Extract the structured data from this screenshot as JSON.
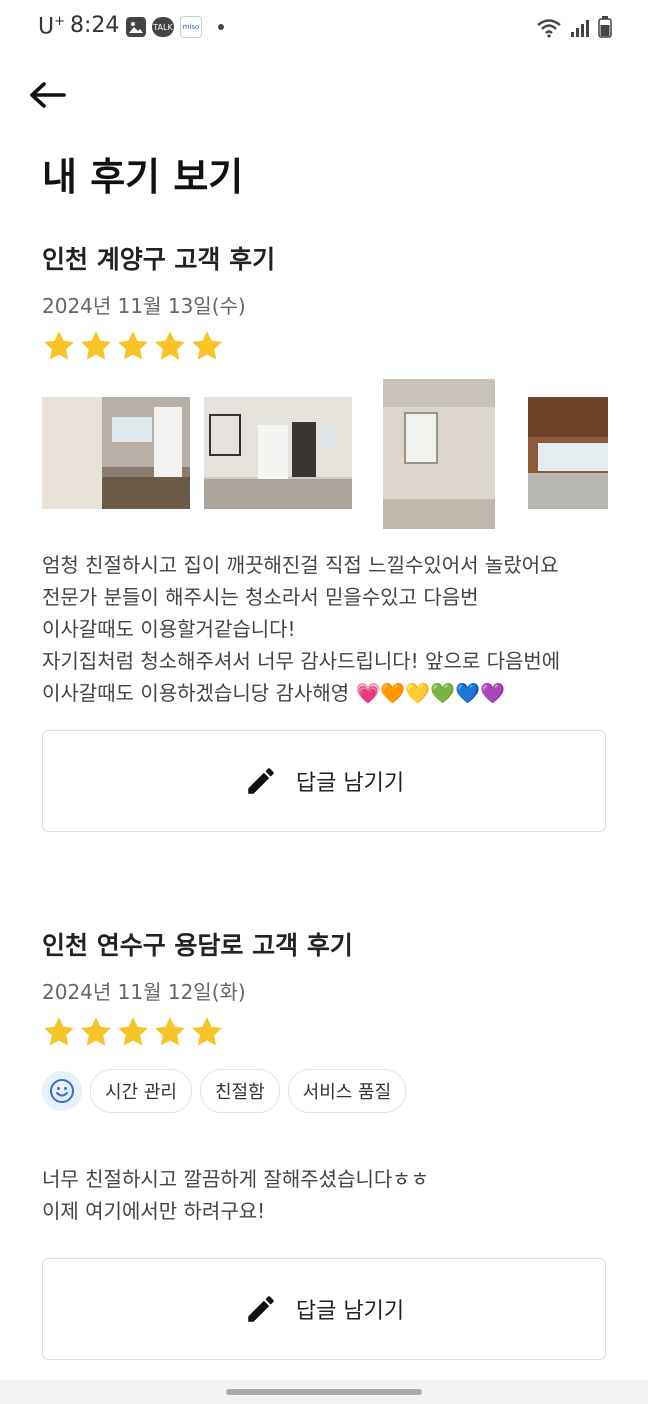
{
  "status_bar": {
    "carrier": "U",
    "carrier_sup": "+",
    "time": "8:24",
    "notif_talk": "TALK",
    "notif_mini": "miso"
  },
  "page": {
    "title": "내 후기 보기"
  },
  "reviews": [
    {
      "title": "인천 계양구 고객 후기",
      "date": "2024년 11월 13일(수)",
      "rating": 5,
      "text_lines": [
        "엄청 친절하시고 집이 깨끗해진걸 직접 느낄수있어서 놀랐어요",
        "전문가 분들이 해주시는 청소라서 믿을수있고 다음번",
        "이사갈때도 이용할거같습니다!",
        "자기집처럼 청소해주셔서 너무 감사드립니다! 앞으로 다음번에",
        "이사갈때도 이용하겠습니당 감사해영 💗🧡💛💚💙💜"
      ],
      "reply_label": "답글 남기기"
    },
    {
      "title": "인천 연수구 용담로 고객 후기",
      "date": "2024년 11월 12일(화)",
      "rating": 5,
      "tags": [
        "시간 관리",
        "친절함",
        "서비스 품질"
      ],
      "text_lines": [
        "너무 친절하시고 깔끔하게 잘해주셨습니다ㅎㅎ",
        "이제 여기에서만 하려구요!"
      ],
      "reply_label": "답글 남기기"
    }
  ],
  "colors": {
    "star": "#F7C325",
    "accent": "#2F6FD6"
  }
}
